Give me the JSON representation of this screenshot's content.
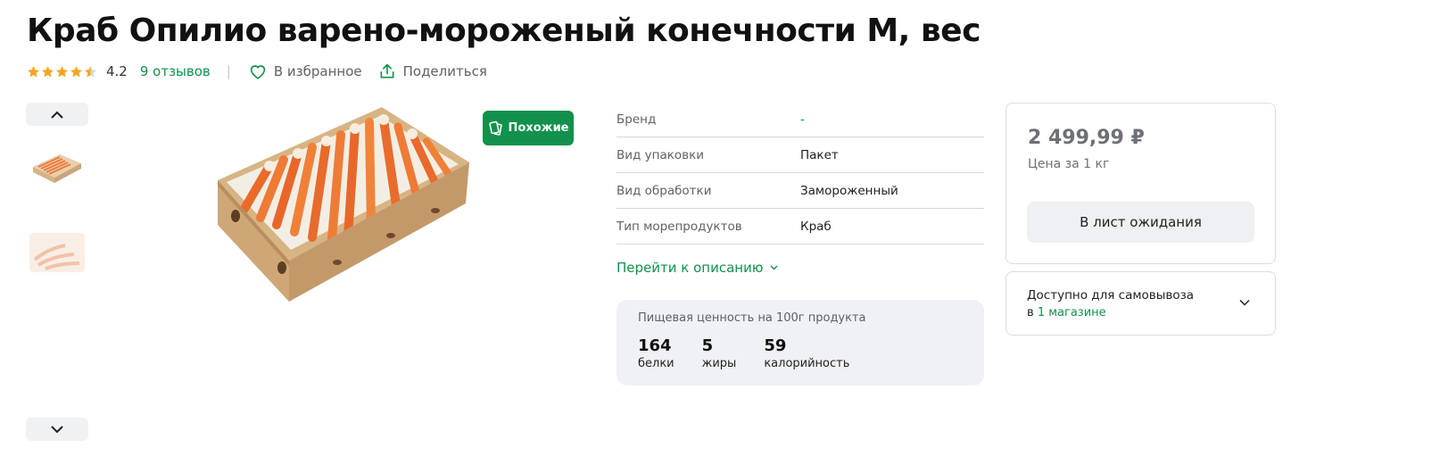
{
  "product": {
    "title": "Краб Опилио варено-мороженый конечности М, вес"
  },
  "rating": {
    "stars": 4.2,
    "value": "4.2",
    "reviews_label": "9 отзывов"
  },
  "actions": {
    "favorite_label": "В избранное",
    "share_label": "Поделиться"
  },
  "gallery": {
    "thumb_up_icon": "chevron-up-icon",
    "thumb_down_icon": "chevron-down-icon"
  },
  "similar_button": {
    "label": "Похожие"
  },
  "specs": [
    {
      "key": "Бренд",
      "value": "-"
    },
    {
      "key": "Вид упаковки",
      "value": "Пакет"
    },
    {
      "key": "Вид обработки",
      "value": "Замороженный"
    },
    {
      "key": "Тип морепродуктов",
      "value": "Краб"
    }
  ],
  "to_description": "Перейти к описанию",
  "nutrition": {
    "title": "Пищевая ценность на 100г продукта",
    "items": [
      {
        "value": "164",
        "label": "белки"
      },
      {
        "value": "5",
        "label": "жиры"
      },
      {
        "value": "59",
        "label": "калорийность"
      }
    ]
  },
  "price_card": {
    "price": "2 499,99 ₽",
    "unit": "Цена за 1 кг",
    "button_label": "В лист ожидания"
  },
  "pickup": {
    "title": "Доступно для самовывоза",
    "prefix": "в",
    "link": "1 магазине"
  },
  "colors": {
    "accent_green": "#11914b",
    "star_gold": "#f5a623",
    "muted_text": "#5e6166"
  }
}
